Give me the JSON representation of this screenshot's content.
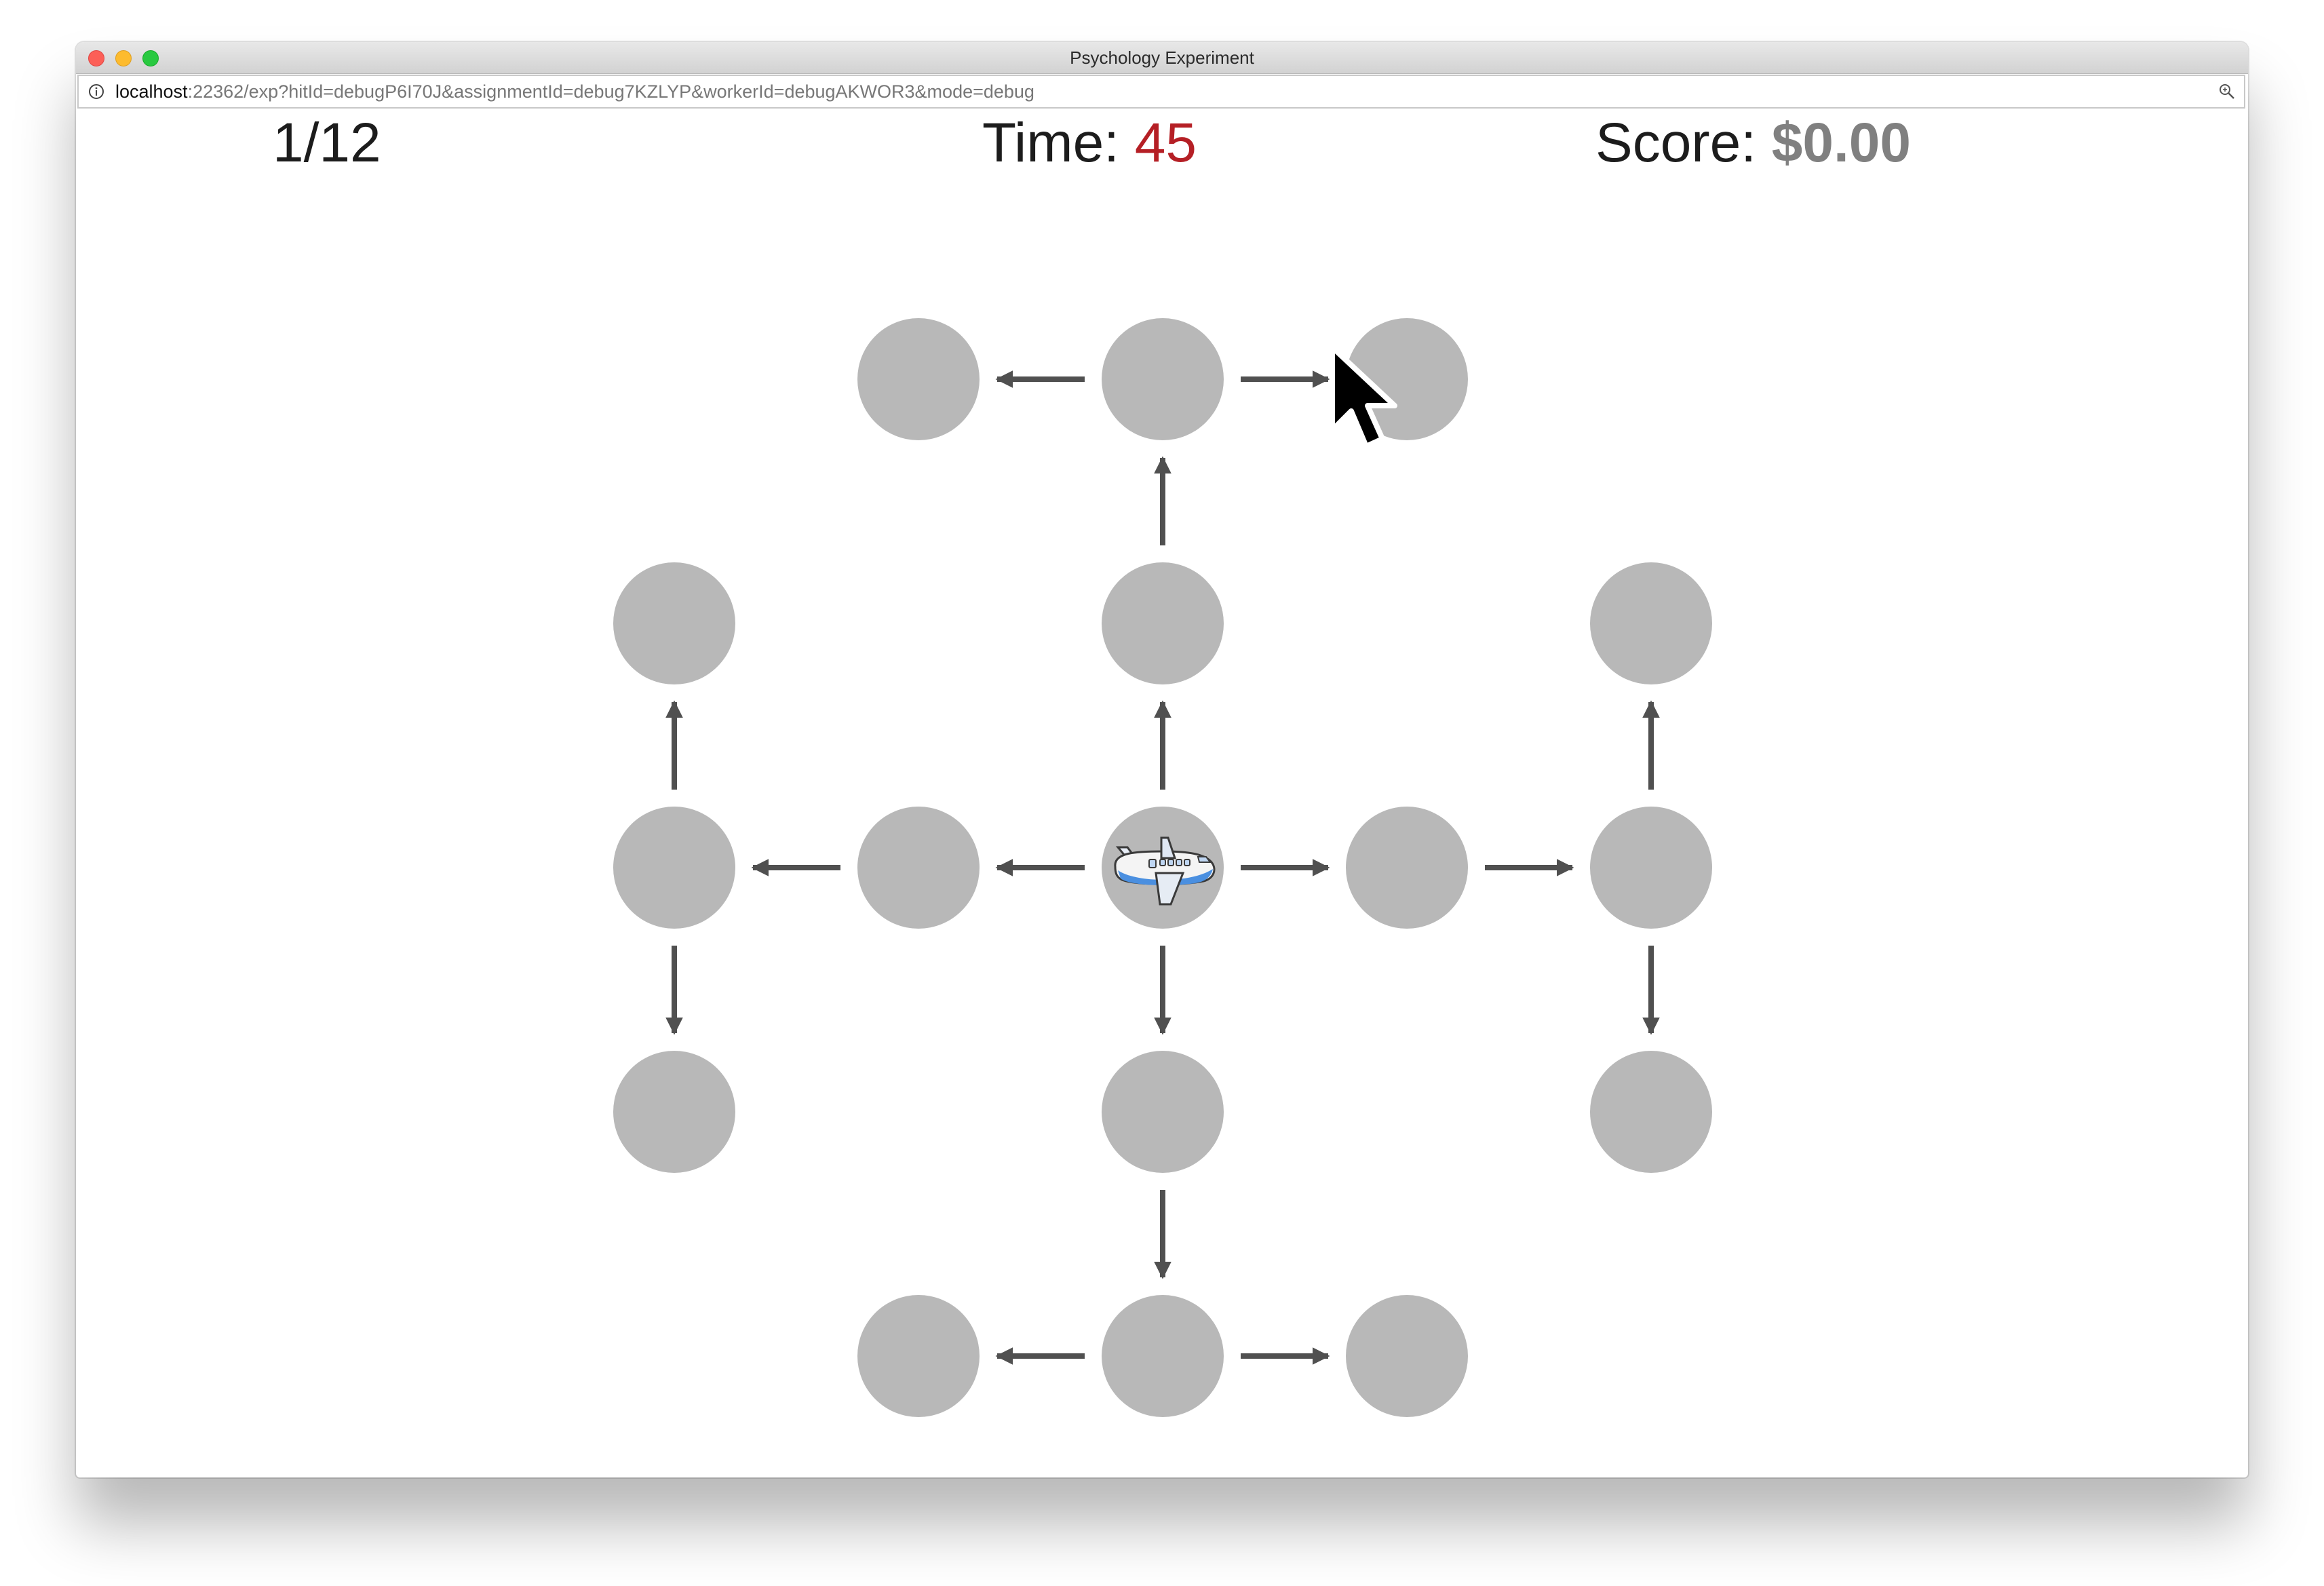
{
  "window": {
    "title": "Psychology Experiment"
  },
  "address_bar": {
    "host": "localhost",
    "path": ":22362/exp?hitId=debugP6I70J&assignmentId=debug7KZLYP&workerId=debugAKWOR3&mode=debug"
  },
  "hud": {
    "trial": "1/12",
    "time_label": "Time: ",
    "time_value": "45",
    "score_label": "Score: ",
    "score_value": "$0.00"
  },
  "colors": {
    "node": "#b8b8b8",
    "arrow": "#505050",
    "time_value": "#b51f25",
    "score_value": "#808080"
  },
  "graph": {
    "nodes": [
      {
        "id": "r0c2"
      },
      {
        "id": "r0c3"
      },
      {
        "id": "r0c4"
      },
      {
        "id": "r1c1"
      },
      {
        "id": "r1c3"
      },
      {
        "id": "r1c5"
      },
      {
        "id": "r2c1"
      },
      {
        "id": "r2c2"
      },
      {
        "id": "r2c3",
        "icon": "airplane-icon"
      },
      {
        "id": "r2c4"
      },
      {
        "id": "r2c5"
      },
      {
        "id": "r3c1"
      },
      {
        "id": "r3c3"
      },
      {
        "id": "r3c5"
      },
      {
        "id": "r4c2"
      },
      {
        "id": "r4c3"
      },
      {
        "id": "r4c4"
      }
    ],
    "edges": [
      {
        "from": "r2c3",
        "to": "r1c3"
      },
      {
        "from": "r1c3",
        "to": "r0c3"
      },
      {
        "from": "r0c3",
        "to": "r0c2"
      },
      {
        "from": "r0c3",
        "to": "r0c4"
      },
      {
        "from": "r2c3",
        "to": "r2c2"
      },
      {
        "from": "r2c2",
        "to": "r2c1"
      },
      {
        "from": "r2c1",
        "to": "r1c1"
      },
      {
        "from": "r2c1",
        "to": "r3c1"
      },
      {
        "from": "r2c3",
        "to": "r2c4"
      },
      {
        "from": "r2c4",
        "to": "r2c5"
      },
      {
        "from": "r2c5",
        "to": "r1c5"
      },
      {
        "from": "r2c5",
        "to": "r3c5"
      },
      {
        "from": "r2c3",
        "to": "r3c3"
      },
      {
        "from": "r3c3",
        "to": "r4c3"
      },
      {
        "from": "r4c3",
        "to": "r4c2"
      },
      {
        "from": "r4c3",
        "to": "r4c4"
      }
    ],
    "current_node": "r2c3",
    "hover_node": "r0c4"
  }
}
